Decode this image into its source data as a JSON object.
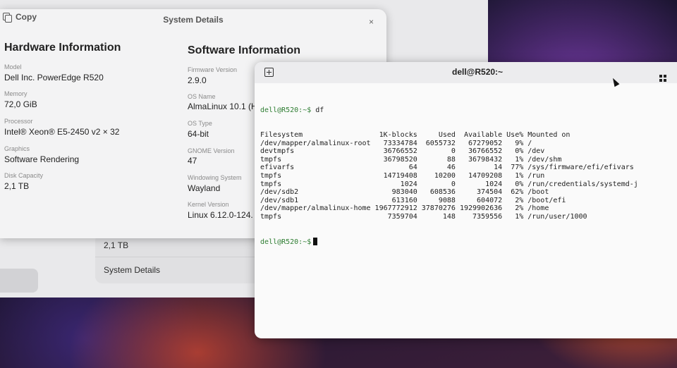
{
  "background_window": {
    "disk_capacity_value": "2,1 TB",
    "system_details_link": "System Details"
  },
  "dialog": {
    "copy_label": "Copy",
    "title": "System Details",
    "close_glyph": "×",
    "hardware": {
      "title": "Hardware Information",
      "fields": [
        {
          "label": "Model",
          "value": "Dell Inc. PowerEdge R520"
        },
        {
          "label": "Memory",
          "value": "72,0 GiB"
        },
        {
          "label": "Processor",
          "value": "Intel® Xeon® E5-2450 v2 × 32"
        },
        {
          "label": "Graphics",
          "value": "Software Rendering"
        },
        {
          "label": "Disk Capacity",
          "value": "2,1 TB"
        }
      ]
    },
    "software": {
      "title": "Software Information",
      "fields": [
        {
          "label": "Firmware Version",
          "value": "2.9.0"
        },
        {
          "label": "OS Name",
          "value": "AlmaLinux 10.1 (H"
        },
        {
          "label": "OS Type",
          "value": "64-bit"
        },
        {
          "label": "GNOME Version",
          "value": "47"
        },
        {
          "label": "Windowing System",
          "value": "Wayland"
        },
        {
          "label": "Kernel Version",
          "value": "Linux 6.12.0-124."
        }
      ]
    }
  },
  "terminal": {
    "title": "dell@R520:~",
    "icons": {
      "new_tab": "new-tab-icon",
      "menu": "menu-icon"
    },
    "prompt": "dell@R520:~$",
    "command": " df",
    "headers": [
      "Filesystem",
      "1K-blocks",
      "Used",
      "Available",
      "Use%",
      "Mounted on"
    ],
    "rows": [
      [
        "/dev/mapper/almalinux-root",
        "73334784",
        "6055732",
        "67279052",
        "9%",
        "/"
      ],
      [
        "devtmpfs",
        "36766552",
        "0",
        "36766552",
        "0%",
        "/dev"
      ],
      [
        "tmpfs",
        "36798520",
        "88",
        "36798432",
        "1%",
        "/dev/shm"
      ],
      [
        "efivarfs",
        "64",
        "46",
        "14",
        "77%",
        "/sys/firmware/efi/efivars"
      ],
      [
        "tmpfs",
        "14719408",
        "10200",
        "14709208",
        "1%",
        "/run"
      ],
      [
        "tmpfs",
        "1024",
        "0",
        "1024",
        "0%",
        "/run/credentials/systemd-j"
      ],
      [
        "/dev/sdb2",
        "983040",
        "608536",
        "374504",
        "62%",
        "/boot"
      ],
      [
        "/dev/sdb1",
        "613160",
        "9088",
        "604072",
        "2%",
        "/boot/efi"
      ],
      [
        "/dev/mapper/almalinux-home",
        "1967772912",
        "37870276",
        "1929902636",
        "2%",
        "/home"
      ],
      [
        "tmpfs",
        "7359704",
        "148",
        "7359556",
        "1%",
        "/run/user/1000"
      ]
    ],
    "final_prompt": "dell@R520:~$"
  }
}
